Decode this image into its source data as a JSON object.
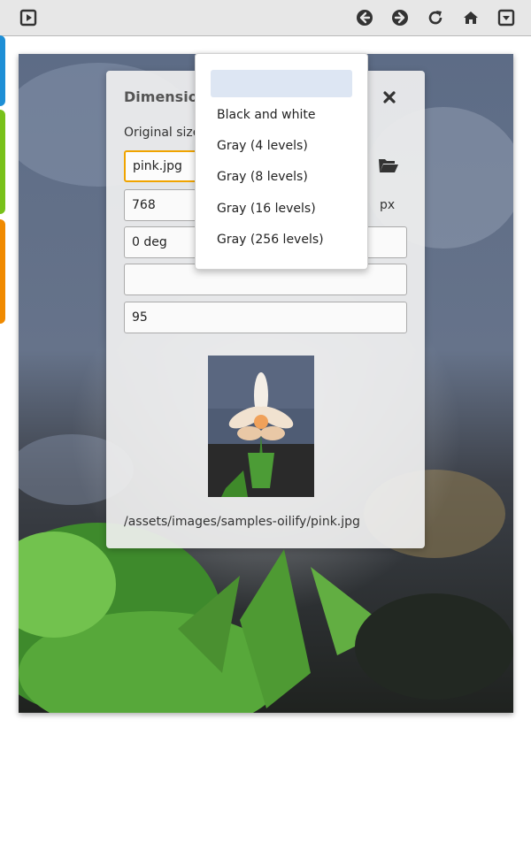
{
  "toolbar": {
    "left_icon": "play-box-icon",
    "right_icons": [
      "arrow-left-icon",
      "arrow-right-icon",
      "refresh-icon",
      "home-icon",
      "dropdown-box-icon"
    ]
  },
  "dialog": {
    "title": "Dimension",
    "original_size_label": "Original size",
    "file_value": "pink.jpg",
    "width_value": "768",
    "unit": "px",
    "angle_value": "0 deg",
    "quality_value": "95",
    "path": "/assets/images/samples-oilify/pink.jpg"
  },
  "menu": {
    "items": [
      "Black and white",
      "Gray (4 levels)",
      "Gray (8 levels)",
      "Gray (16 levels)",
      "Gray (256 levels)"
    ]
  },
  "colors": {
    "toolbar_bg": "#e7e7e7",
    "strip_blue": "#1e8fd6",
    "strip_green": "#78c11a",
    "strip_orange": "#f08a00",
    "focus_border": "#f0a400",
    "menu_highlight": "#dde6f3"
  }
}
